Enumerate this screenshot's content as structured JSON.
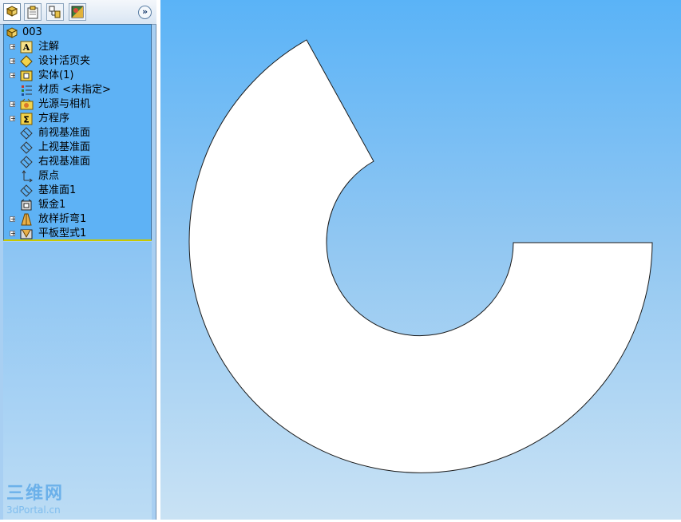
{
  "tabs": [
    {
      "icon": "feature-manager-icon",
      "active": true
    },
    {
      "icon": "property-manager-icon",
      "active": false
    },
    {
      "icon": "configuration-manager-icon",
      "active": false
    },
    {
      "icon": "display-manager-icon",
      "active": false
    }
  ],
  "expand_label": "»",
  "tree": {
    "root": {
      "label": "003",
      "icon": "part-icon"
    },
    "items": [
      {
        "label": "注解",
        "icon": "annotations-icon",
        "expandable": true
      },
      {
        "label": "设计活页夹",
        "icon": "design-binder-icon",
        "expandable": true
      },
      {
        "label": "实体(1)",
        "icon": "solid-bodies-icon",
        "expandable": true
      },
      {
        "label": "材质 <未指定>",
        "icon": "material-icon",
        "expandable": false
      },
      {
        "label": "光源与相机",
        "icon": "lights-cameras-icon",
        "expandable": true
      },
      {
        "label": "方程序",
        "icon": "equations-icon",
        "expandable": true
      },
      {
        "label": "前视基准面",
        "icon": "plane-icon",
        "expandable": false
      },
      {
        "label": "上视基准面",
        "icon": "plane-icon",
        "expandable": false
      },
      {
        "label": "右视基准面",
        "icon": "plane-icon",
        "expandable": false
      },
      {
        "label": "原点",
        "icon": "origin-icon",
        "expandable": false
      },
      {
        "label": "基准面1",
        "icon": "plane-icon",
        "expandable": false
      },
      {
        "label": "钣金1",
        "icon": "sheet-metal-icon",
        "expandable": false
      },
      {
        "label": "放样折弯1",
        "icon": "lofted-bend-icon",
        "expandable": true
      },
      {
        "label": "平板型式1",
        "icon": "flat-pattern-icon",
        "expandable": true
      }
    ]
  },
  "watermark": {
    "line1": "三维网",
    "line2": "3dPortal.cn"
  },
  "colors": {
    "tree_bg": "#5eb2f5",
    "canvas_top": "#5ab3f7",
    "canvas_bottom": "#c9e2f4",
    "part_fill": "#ffffff"
  }
}
